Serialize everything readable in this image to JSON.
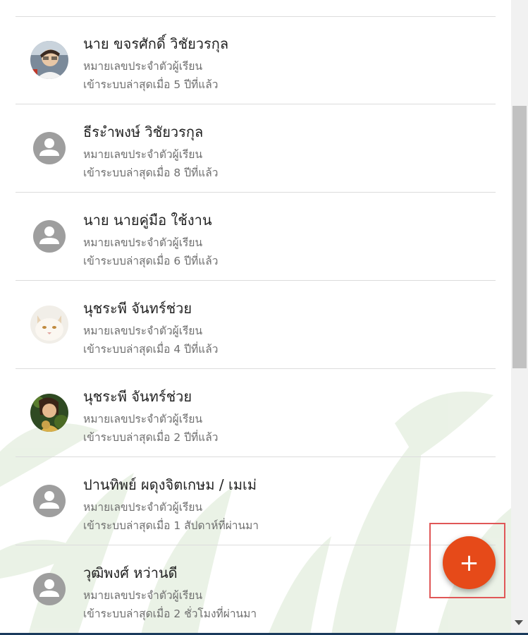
{
  "students": [
    {
      "name": "นาย ขจรศักดิ์ วิชัยวรกุล",
      "id_label": "หมายเลขประจำตัวผู้เรียน",
      "last_login": "เข้าระบบล่าสุดเมื่อ 5 ปีที่แล้ว",
      "avatar": "photo-man"
    },
    {
      "name": "ธีระำพงษ์ วิชัยวรกุล",
      "id_label": "หมายเลขประจำตัวผู้เรียน",
      "last_login": "เข้าระบบล่าสุดเมื่อ 8 ปีที่แล้ว",
      "avatar": "default-person-icon"
    },
    {
      "name": "นาย นายคู่มือ ใช้งาน",
      "id_label": "หมายเลขประจำตัวผู้เรียน",
      "last_login": "เข้าระบบล่าสุดเมื่อ 6 ปีที่แล้ว",
      "avatar": "default-person-icon"
    },
    {
      "name": "นุชระพี จันทร์ช่วย",
      "id_label": "หมายเลขประจำตัวผู้เรียน",
      "last_login": "เข้าระบบล่าสุดเมื่อ 4 ปีที่แล้ว",
      "avatar": "photo-cat"
    },
    {
      "name": "นุชระพี จันทร์ช่วย",
      "id_label": "หมายเลขประจำตัวผู้เรียน",
      "last_login": "เข้าระบบล่าสุดเมื่อ 2 ปีที่แล้ว",
      "avatar": "photo-woman"
    },
    {
      "name": "ปานทิพย์ ผดุงจิตเกษม / เมเม่",
      "id_label": "หมายเลขประจำตัวผู้เรียน",
      "last_login": "เข้าระบบล่าสุดเมื่อ 1 สัปดาห์ที่ผ่านมา",
      "avatar": "default-person-icon"
    },
    {
      "name": "วุฒิพงศ์ หว่านดี",
      "id_label": "หมายเลขประจำตัวผู้เรียน",
      "last_login": "เข้าระบบล่าสุดเมื่อ 2 ชั่วโมงที่ผ่านมา",
      "avatar": "default-person-icon"
    }
  ],
  "fab": {
    "label": "+",
    "color": "#e64a19",
    "highlight_color": "#e05757"
  },
  "colors": {
    "divider": "#dcdcdc",
    "name_text": "#222222",
    "sub_text": "#6f6f6f",
    "default_avatar": "#9e9e9e"
  }
}
